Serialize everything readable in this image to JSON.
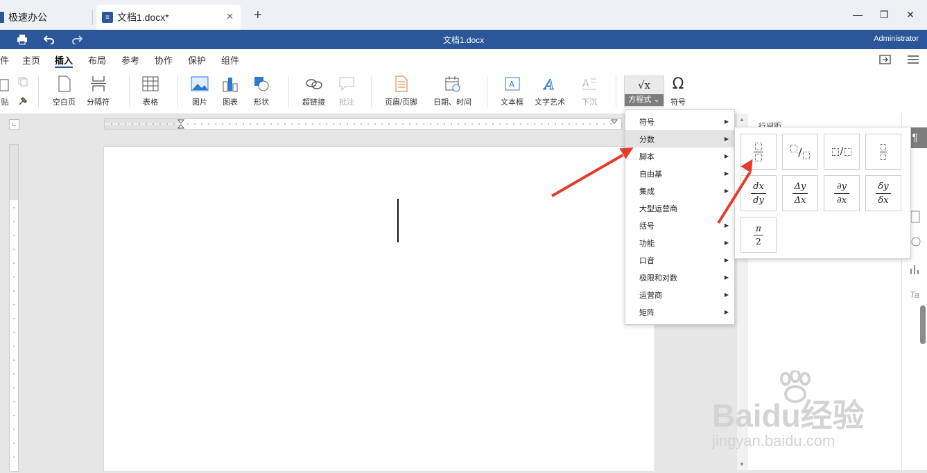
{
  "tabs": [
    {
      "label": "极速办公"
    },
    {
      "label": "文档1.docx*"
    }
  ],
  "new_tab_label": "+",
  "titlebar": {
    "title": "文档1.docx",
    "user": "Administrator"
  },
  "menu": [
    "件",
    "主页",
    "插入",
    "布局",
    "参考",
    "协作",
    "保护",
    "组件"
  ],
  "toolbar": {
    "paste": "贴",
    "blank_page": "空白页",
    "page_break": "分隔符",
    "table": "表格",
    "picture": "图片",
    "chart": "图表",
    "shape": "形状",
    "hyperlink": "超链接",
    "comment": "批注",
    "header_footer": "页眉/页脚",
    "datetime": "日期、时间",
    "textbox": "文本框",
    "textart": "文字艺术",
    "dropcap": "下沉",
    "equation": "方程式",
    "symbol": "符号",
    "equation_icon": "√x",
    "symbol_icon": "Ω"
  },
  "dropdown": {
    "items": [
      "符号",
      "分数",
      "脚本",
      "自由基",
      "集成",
      "大型运营商",
      "括号",
      "功能",
      "口音",
      "极限和对数",
      "运营商",
      "矩阵"
    ],
    "selected": "分数"
  },
  "fractions": {
    "dx_dy": [
      "dx",
      "dy"
    ],
    "dy_dx_delta": [
      "Δy",
      "Δx"
    ],
    "partial": [
      "∂y",
      "∂x"
    ],
    "small_delta": [
      "δy",
      "δx"
    ],
    "pi_2": [
      "π",
      "2"
    ],
    "slash": "/"
  },
  "right_pane": {
    "heading": "行间距"
  },
  "watermark": {
    "brand": "Baidu经验",
    "url": "jingyan.baidu.com"
  },
  "colors": {
    "titlebar": "#2b579a",
    "arrow": "#e8392e",
    "selected": "#e4e4e4"
  }
}
